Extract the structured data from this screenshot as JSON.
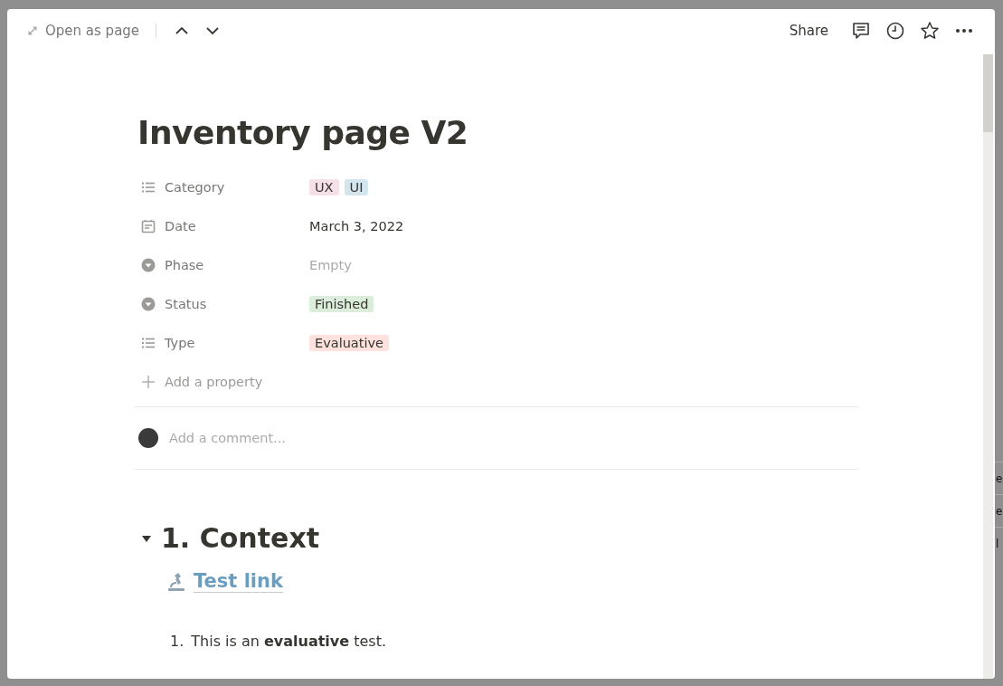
{
  "topbar": {
    "open_as_page": "Open as page",
    "share": "Share"
  },
  "page": {
    "title": "Inventory page V2",
    "properties": [
      {
        "kind": "multi_select",
        "name": "Category",
        "tags": [
          {
            "label": "UX",
            "color": "#f5e0e9"
          },
          {
            "label": "UI",
            "color": "#d3e5ef"
          }
        ]
      },
      {
        "kind": "date",
        "name": "Date",
        "value": "March 3, 2022"
      },
      {
        "kind": "select",
        "name": "Phase",
        "placeholder": "Empty"
      },
      {
        "kind": "select",
        "name": "Status",
        "tags": [
          {
            "label": "Finished",
            "color": "#dbeddb"
          }
        ]
      },
      {
        "kind": "multi_select",
        "name": "Type",
        "tags": [
          {
            "label": "Evaluative",
            "color": "#ffe2dd"
          }
        ]
      }
    ],
    "add_property": "Add a property",
    "comment": {
      "placeholder": "Add a comment..."
    },
    "sections": [
      {
        "heading": "1. Context",
        "expanded": true,
        "link": "Test link",
        "list": [
          {
            "number": "1.",
            "text": "This is an **evaluative** test."
          }
        ]
      }
    ]
  },
  "background_table": {
    "cells": [
      "e",
      "e",
      "l"
    ]
  }
}
